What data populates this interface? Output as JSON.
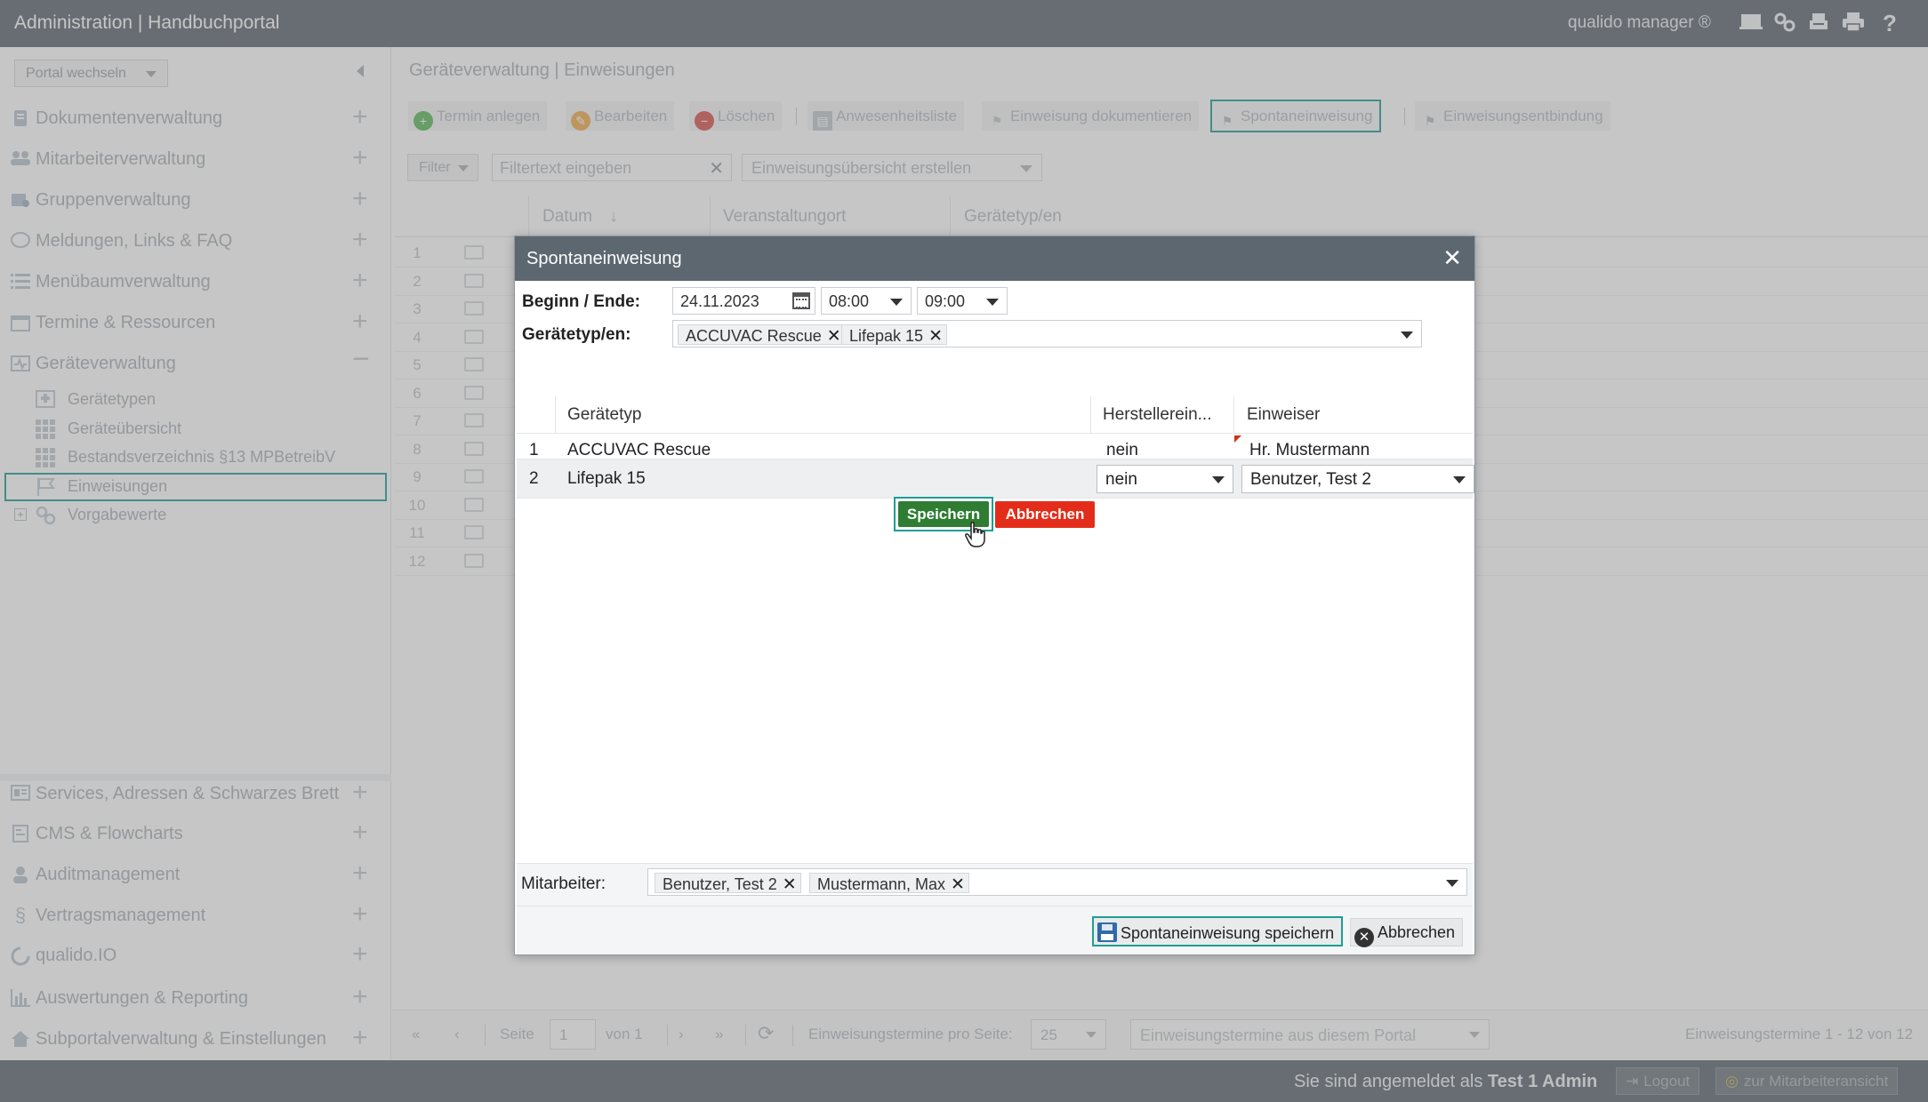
{
  "app": {
    "title": "Administration | Handbuchportal",
    "brand": "qualido manager ®"
  },
  "sidebar": {
    "portal_select": "Portal wechseln",
    "items": [
      {
        "label": "Dokumentenverwaltung",
        "icon": "document-icon"
      },
      {
        "label": "Mitarbeiterverwaltung",
        "icon": "users-icon"
      },
      {
        "label": "Gruppenverwaltung",
        "icon": "group-icon"
      },
      {
        "label": "Meldungen, Links & FAQ",
        "icon": "chat-icon"
      },
      {
        "label": "Menübaumverwaltung",
        "icon": "list-icon"
      },
      {
        "label": "Termine & Ressourcen",
        "icon": "calendar-icon"
      },
      {
        "label": "Geräteverwaltung",
        "icon": "device-icon"
      }
    ],
    "sub_items": [
      {
        "label": "Gerätetypen"
      },
      {
        "label": "Geräteübersicht"
      },
      {
        "label": "Bestandsverzeichnis §13 MPBetreibV"
      },
      {
        "label": "Einweisungen"
      },
      {
        "label": "Vorgabewerte"
      }
    ],
    "bottom_items": [
      {
        "label": "Services, Adressen & Schwarzes Brett"
      },
      {
        "label": "CMS & Flowcharts"
      },
      {
        "label": "Auditmanagement"
      },
      {
        "label": "Vertragsmanagement"
      },
      {
        "label": "qualido.IO"
      },
      {
        "label": "Auswertungen & Reporting"
      },
      {
        "label": "Subportalverwaltung & Einstellungen"
      }
    ]
  },
  "main": {
    "breadcrumb": "Geräteverwaltung | Einweisungen",
    "toolbar": {
      "termin_anlegen": "Termin anlegen",
      "bearbeiten": "Bearbeiten",
      "loeschen": "Löschen",
      "anwesenheitsliste": "Anwesenheitsliste",
      "einweisung_dokumentieren": "Einweisung dokumentieren",
      "spontaneinweisung": "Spontaneinweisung",
      "einweisungsentbindung": "Einweisungsentbindung"
    },
    "filter": {
      "button": "Filter",
      "placeholder": "Filtertext eingeben",
      "overview": "Einweisungsübersicht erstellen"
    },
    "columns": {
      "datum": "Datum",
      "veranstaltungsort": "Veranstaltungort",
      "geraetetyp": "Gerätetyp/en"
    },
    "row_numbers": [
      "1",
      "2",
      "3",
      "4",
      "5",
      "6",
      "7",
      "8",
      "9",
      "10",
      "11",
      "12"
    ]
  },
  "pager": {
    "seite_label": "Seite",
    "page": "1",
    "von": "von 1",
    "per_page_label": "Einweisungstermine pro Seite:",
    "per_page": "25",
    "source": "Einweisungstermine aus diesem Portal",
    "summary": "Einweisungstermine 1 - 12 von 12"
  },
  "statusbar": {
    "login_prefix": "Sie sind angemeldet als ",
    "user": "Test 1 Admin",
    "logout": "Logout",
    "employee_view": "zur Mitarbeiteransicht"
  },
  "dialog": {
    "title": "Spontaneinweisung",
    "begin_end_label": "Beginn / Ende:",
    "date": "24.11.2023",
    "start_time": "08:00",
    "end_time": "09:00",
    "device_types_label": "Gerätetyp/en:",
    "device_tags": [
      "ACCUVAC Rescue",
      "Lifepak 15"
    ],
    "table": {
      "headers": {
        "geraetetyp": "Gerätetyp",
        "hersteller": "Herstellerein...",
        "einweiser": "Einweiser"
      },
      "rows": [
        {
          "num": "1",
          "geraetetyp": "ACCUVAC Rescue",
          "hersteller": "nein",
          "einweiser": "Hr. Mustermann"
        },
        {
          "num": "2",
          "geraetetyp": "Lifepak 15",
          "hersteller": "nein",
          "einweiser": "Benutzer, Test 2"
        }
      ]
    },
    "row_save": "Speichern",
    "row_cancel": "Abbrechen",
    "employees_label": "Mitarbeiter:",
    "employee_tags": [
      "Benutzer, Test 2",
      "Mustermann, Max"
    ],
    "save_button": "Spontaneinweisung speichern",
    "cancel_button": "Abbrechen"
  },
  "colors": {
    "topbar": "#5c6770",
    "highlight": "#1d9e94",
    "save_green": "#2e7d32",
    "cancel_red": "#e32d1a"
  }
}
